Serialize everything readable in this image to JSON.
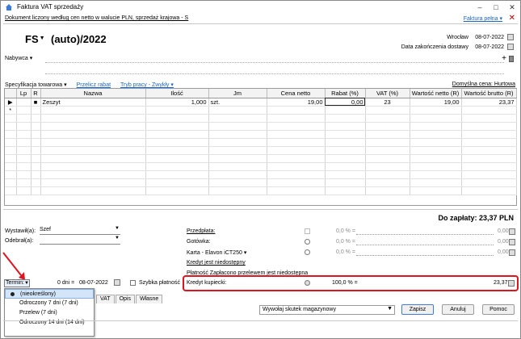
{
  "window": {
    "title": "Faktura VAT sprzedaży",
    "subtitle": "Dokument liczony według cen netto w walucie PLN, sprzedaż krajowa - S",
    "mode_link": "Faktura pełna ▾"
  },
  "header": {
    "doc_prefix": "FS",
    "doc_number": "(auto)/2022",
    "place": "Wrocław",
    "issue_date": "08-07-2022",
    "delivery_label": "Data zakończenia dostawy",
    "delivery_date": "08-07-2022",
    "buyer_label": "Nabywca",
    "buyer_add": "+"
  },
  "spec_bar": {
    "spec_label": "Specyfikacja towarowa",
    "discount_link": "Przelicz rabat",
    "mode_link": "Tryb pracy - Zwykły",
    "default_price": "Domyślna cena: Hurtowa"
  },
  "grid": {
    "headers": [
      "Lp",
      "R",
      "Nazwa",
      "Ilość",
      "Jm",
      "Cena netto",
      "Rabat (%)",
      "VAT (%)",
      "Wartość netto (R)",
      "Wartość brutto (R)"
    ],
    "rows": [
      {
        "marker": "▶",
        "lp": "",
        "r": "■",
        "name": "Zeszyt",
        "qty": "1,000",
        "unit": "szt.",
        "price": "19,00",
        "discount": "0,00",
        "vat": "23",
        "net": "19,00",
        "gross": "23,37"
      }
    ],
    "new_row_marker": "*"
  },
  "total": {
    "label": "Do zapłaty: 23,37 PLN"
  },
  "people": {
    "issued_label": "Wystawił(a):",
    "issued_value": "Szef",
    "received_label": "Odebrał(a):",
    "received_value": ""
  },
  "payments": {
    "prepayment": {
      "label": "Przedpłata:",
      "pct": "0,0 % =",
      "value": "0,00"
    },
    "cash": {
      "label": "Gotówka:",
      "pct": "0,0 % =",
      "value": "0,00"
    },
    "card": {
      "label": "Karta - Elavon iCT250",
      "pct": "0,0 % =",
      "value": "0,00"
    },
    "credit_note": "Kredyt jest niedostępny",
    "transfer_note": "Płatność Zapłacono przelewem jest niedostępna",
    "buyer_credit": {
      "label": "Kredyt kupiecki:",
      "pct": "100,0 % =",
      "value": "23,37"
    }
  },
  "terms": {
    "label": "Termin:",
    "days": "0 dni =",
    "date": "08-07-2022",
    "quick_payment": "Szybka płatność",
    "options": [
      "(nieokreślony)",
      "Odroczony 7 dni (7 dni)",
      "Przelew (7 dni)",
      "Odroczony 14 dni (14 dni)"
    ]
  },
  "tabs": [
    "VAT",
    "Opis",
    "Własne"
  ],
  "footer": {
    "action": "Wywołaj skutek magazynowy",
    "save": "Zapisz",
    "cancel": "Anuluj",
    "help": "Pomoc"
  },
  "colors": {
    "accent": "#1a66c9",
    "highlight": "#e0141e"
  }
}
